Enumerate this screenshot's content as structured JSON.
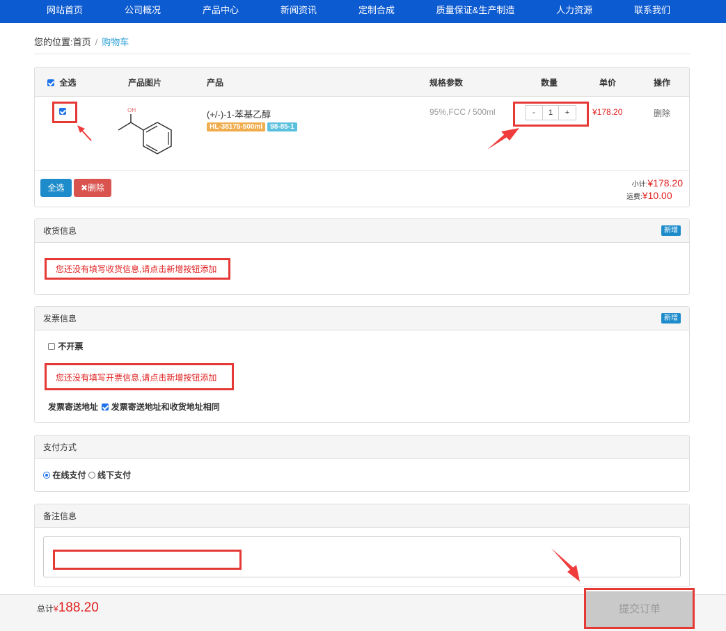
{
  "nav": [
    "网站首页",
    "公司概况",
    "产品中心",
    "新闻资讯",
    "定制合成",
    "质量保证&生产制造",
    "人力资源",
    "联系我们"
  ],
  "breadcrumb": {
    "prefix": "您的位置:",
    "home": "首页",
    "sep": "/",
    "current": "购物车"
  },
  "cart": {
    "headers": {
      "select_all": "全选",
      "image": "产品图片",
      "product": "产品",
      "spec": "规格参数",
      "qty": "数量",
      "price": "单价",
      "action": "操作"
    },
    "item": {
      "name": "(+/-)-1-苯基乙醇",
      "tag1": "HL-38175-500ml",
      "tag2": "98-85-1",
      "spec": "95%,FCC / 500ml",
      "qty_minus": "-",
      "qty": "1",
      "qty_plus": "+",
      "price": "¥178.20",
      "delete": "删除",
      "structure_label": "OH"
    },
    "select_all_button": "全选",
    "delete_button": "✖删除",
    "subtotal_label": "小计:",
    "subtotal_value": "¥178.20",
    "shipping_label": "运费:",
    "shipping_value": "¥10.00"
  },
  "shipping": {
    "title": "收货信息",
    "new_button": "新增",
    "warning": "您还没有填写收货信息,请点击新增按钮添加"
  },
  "invoice": {
    "title": "发票信息",
    "new_button": "新增",
    "no_invoice": "不开票",
    "warning": "您还没有填写开票信息,请点击新增按钮添加",
    "address_label": "发票寄送地址",
    "same_address": "发票寄送地址和收货地址相同"
  },
  "payment": {
    "title": "支付方式",
    "online": "在线支付",
    "offline": "线下支付"
  },
  "remark": {
    "title": "备注信息",
    "value": ""
  },
  "footer": {
    "total_label": "总计",
    "currency": "¥",
    "total_value": "188.20",
    "submit": "提交订单"
  },
  "colors": {
    "nav": "#0d5bd1",
    "highlight": "#e53935",
    "accent": "#1e8ccb",
    "tag1": "#f0ad4e",
    "tag2": "#5bc0de"
  }
}
